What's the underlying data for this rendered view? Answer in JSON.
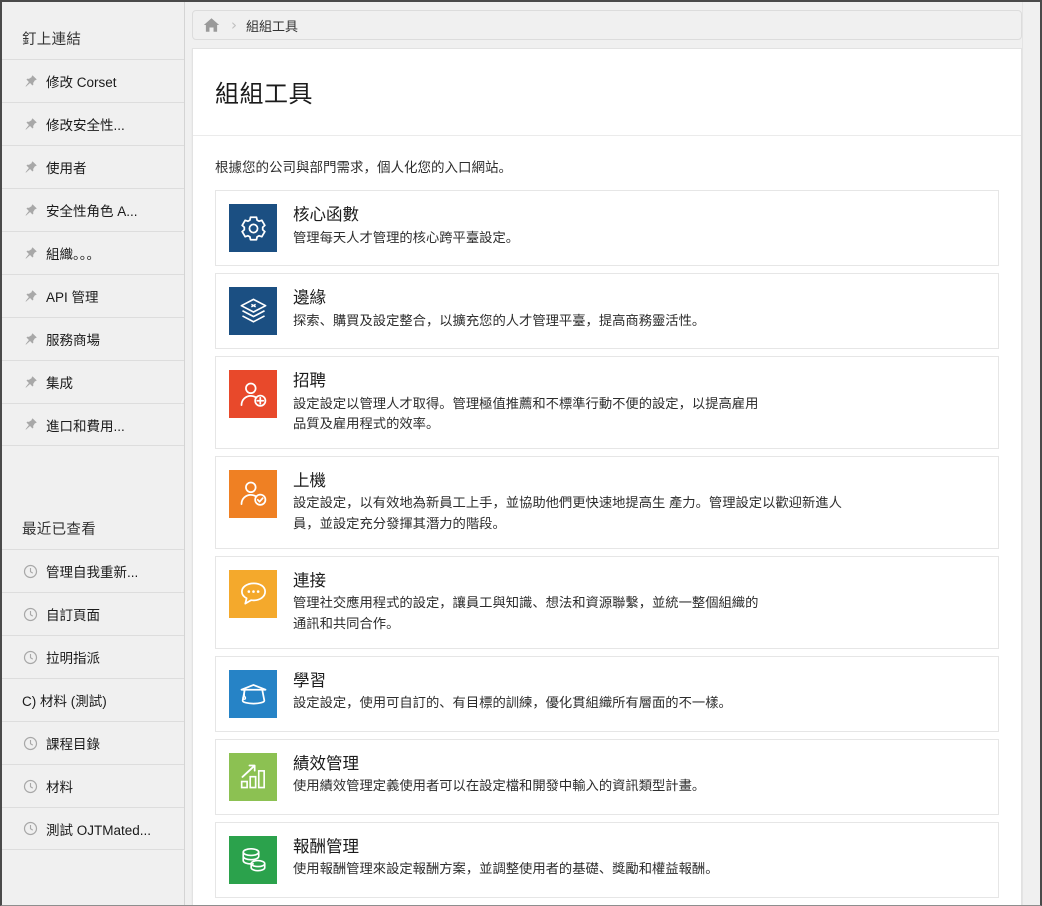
{
  "breadcrumb": {
    "home_icon": "home-icon",
    "separator": "›",
    "current": "組組工具"
  },
  "page": {
    "title": "組組工具",
    "subtitle": "根據您的公司與部門需求，個人化您的入口網站。"
  },
  "sidebar": {
    "pinned": {
      "title": "釘上連結",
      "items": [
        {
          "label": "修改 Corset",
          "icon": "pin-icon"
        },
        {
          "label": "修改安全性...",
          "icon": "pin-icon"
        },
        {
          "label": "使用者",
          "icon": "pin-icon"
        },
        {
          "label": "安全性角色 A...",
          "icon": "pin-icon"
        },
        {
          "label": "組織。。。",
          "icon": "pin-icon"
        },
        {
          "label": "API 管理",
          "icon": "pin-icon"
        },
        {
          "label": "服務商場",
          "icon": "pin-icon"
        },
        {
          "label": "集成",
          "icon": "pin-icon"
        },
        {
          "label": "進口和費用...",
          "icon": "pin-icon"
        }
      ]
    },
    "recent": {
      "title": "最近已查看",
      "items": [
        {
          "label": "管理自我重新...",
          "icon": "clock-icon"
        },
        {
          "label": "自訂頁面",
          "icon": "clock-icon"
        },
        {
          "label": "拉明指派",
          "icon": "clock-icon"
        },
        {
          "label": "C) 材料 (測試)",
          "icon": "text-icon"
        },
        {
          "label": "課程目錄",
          "icon": "clock-icon"
        },
        {
          "label": "材料",
          "icon": "clock-icon"
        },
        {
          "label": "測試 OJTMated...",
          "icon": "clock-icon"
        }
      ]
    }
  },
  "tiles": [
    {
      "name": "核心函數",
      "desc": "管理每天人才管理的核心跨平臺設定。",
      "icon": "gear-icon",
      "color": "#1b4f82"
    },
    {
      "name": "邊緣",
      "desc": "探索、購買及設定整合，以擴充您的人才管理平臺，提高商務靈活性。",
      "icon": "layers-icon",
      "color": "#1b4f82"
    },
    {
      "name": "招聘",
      "desc": "設定設定以管理人才取得。管理極值推薦和不標準行動不便的設定，以提高雇用品質及雇用程式的效率。",
      "icon": "person-add-icon",
      "color": "#e8492b"
    },
    {
      "name": "上機",
      "desc": "設定設定，以有效地為新員工上手，並協助他們更快速地提高生 產力。管理設定以歡迎新進人員，並設定充分發揮其潛力的階段。",
      "icon": "person-check-icon",
      "color": "#ef8023"
    },
    {
      "name": "連接",
      "desc": "管理社交應用程式的設定，讓員工與知識、想法和資源聯繫，並統一整個組織的通訊和共同合作。",
      "icon": "chat-icon",
      "color": "#f4a92c"
    },
    {
      "name": "學習",
      "desc": "設定設定，使用可自訂的、有目標的訓練，優化貫組織所有層面的不一樣。",
      "icon": "graduation-cap-icon",
      "color": "#2683c6"
    },
    {
      "name": "績效管理",
      "desc": "使用績效管理定義使用者可以在設定檔和開發中輸入的資訊類型計畫。",
      "icon": "bar-chart-icon",
      "color": "#8cc152"
    },
    {
      "name": "報酬管理",
      "desc": "使用報酬管理來設定報酬方案，並調整使用者的基礎、獎勵和權益報酬。",
      "icon": "coins-icon",
      "color": "#2ba24c"
    }
  ],
  "theme": {
    "sidebar_bg": "#f0f0f0",
    "content_bg": "#ffffff",
    "border": "#e6e6e6",
    "text": "#1b1b1b"
  }
}
